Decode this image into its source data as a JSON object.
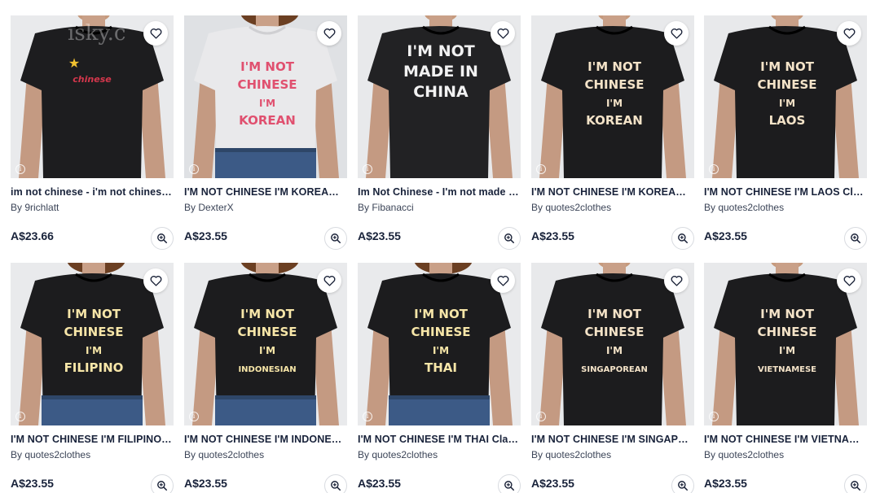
{
  "products": [
    {
      "title": "im not chinese - i'm not chinese ...",
      "artist": "By 9richlatt",
      "price": "A$23.66",
      "lines": [
        "chinese"
      ],
      "shirt": "#1d1d1f",
      "text_color": "#d4374c",
      "bg": "#e9eaec",
      "watermark": "isky.c"
    },
    {
      "title": "I'M NOT CHINESE I'M KOREAN Cl...",
      "artist": "By DexterX",
      "price": "A$23.55",
      "lines": [
        "I'M NOT",
        "CHINESE",
        "I'M",
        "KOREAN"
      ],
      "shirt": "#e9e9eb",
      "text_color": "#e0506f",
      "bg": "#dfe1e4"
    },
    {
      "title": "Im Not Chinese - I'm not made in...",
      "artist": "By Fibanacci",
      "price": "A$23.55",
      "lines": [
        "I'M NOT",
        "MADE IN",
        "CHINA"
      ],
      "shirt": "#222224",
      "text_color": "#f2f2f2",
      "bg": "#e8e9eb"
    },
    {
      "title": "I'M NOT CHINESE I'M KOREAN Cl...",
      "artist": "By quotes2clothes",
      "price": "A$23.55",
      "lines": [
        "I'M NOT",
        "CHINESE",
        "I'M",
        "KOREAN"
      ],
      "shirt": "#1c1c1e",
      "text_color": "#f4e3c8",
      "bg": "#e8e9eb"
    },
    {
      "title": "I'M NOT CHINESE I'M LAOS Clas...",
      "artist": "By quotes2clothes",
      "price": "A$23.55",
      "lines": [
        "I'M NOT",
        "CHINESE",
        "I'M",
        "LAOS"
      ],
      "shirt": "#1c1c1e",
      "text_color": "#f4e3c8",
      "bg": "#e8e9eb"
    },
    {
      "title": "I'M NOT CHINESE I'M FILIPINO C...",
      "artist": "By quotes2clothes",
      "price": "A$23.55",
      "lines": [
        "I'M NOT",
        "CHINESE",
        "I'M",
        "FILIPINO"
      ],
      "shirt": "#1c1c1e",
      "text_color": "#f7e6a8",
      "bg": "#e9eaec"
    },
    {
      "title": "I'M NOT CHINESE I'M INDONESI...",
      "artist": "By quotes2clothes",
      "price": "A$23.55",
      "lines": [
        "I'M NOT",
        "CHINESE",
        "I'M",
        "INDONESIAN"
      ],
      "shirt": "#1c1c1e",
      "text_color": "#f7e6a8",
      "bg": "#e9eaec"
    },
    {
      "title": "I'M NOT CHINESE I'M THAI Class...",
      "artist": "By quotes2clothes",
      "price": "A$23.55",
      "lines": [
        "I'M NOT",
        "CHINESE",
        "I'M",
        "THAI"
      ],
      "shirt": "#1c1c1e",
      "text_color": "#f7e6a8",
      "bg": "#e9eaec"
    },
    {
      "title": "I'M NOT CHINESE I'M SINGAPOR...",
      "artist": "By quotes2clothes",
      "price": "A$23.55",
      "lines": [
        "I'M NOT",
        "CHINESE",
        "I'M",
        "SINGAPOREAN"
      ],
      "shirt": "#1c1c1e",
      "text_color": "#f4e3c8",
      "bg": "#e8e9eb"
    },
    {
      "title": "I'M NOT CHINESE I'M VIETNAME...",
      "artist": "By quotes2clothes",
      "price": "A$23.55",
      "lines": [
        "I'M NOT",
        "CHINESE",
        "I'M",
        "VIETNAMESE"
      ],
      "shirt": "#1c1c1e",
      "text_color": "#f4e3c8",
      "bg": "#e8e9eb"
    }
  ],
  "icons": {
    "favorite": "heart-outline-icon",
    "zoom": "zoom-in-icon",
    "info": "info-icon"
  }
}
